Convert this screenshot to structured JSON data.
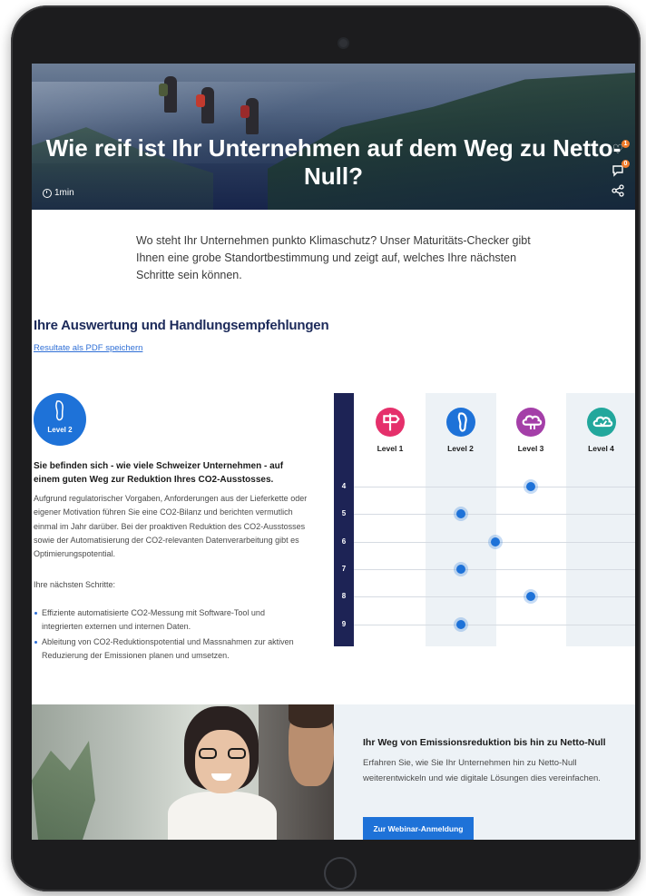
{
  "hero": {
    "title": "Wie reif ist Ihr Unternehmen auf dem Weg zu Netto-Null?",
    "duration": "1min",
    "like_count": "1",
    "comment_count": "0"
  },
  "intro": "Wo steht Ihr Unternehmen punkto Klimaschutz? Unser Maturitäts-Checker gibt Ihnen eine grobe Standortbestimmung und zeigt auf, welches Ihre nächsten Schritte sein können.",
  "evaluation": {
    "title": "Ihre Auswertung und Handlungsempfehlungen",
    "pdf_link": "Resultate als PDF speichern"
  },
  "result": {
    "level_label": "Level 2",
    "headline": "Sie befinden sich - wie viele Schweizer Unternehmen - auf einem guten Weg zur Reduktion Ihres CO2-Ausstosses.",
    "body": "Aufgrund regulatorischer Vorgaben, Anforderungen aus der Lieferkette oder eigener Motivation führen Sie eine CO2-Bilanz und berichten vermutlich einmal im Jahr darüber. Bei der proaktiven Reduktion des CO2-Ausstosses sowie der Automatisierung der CO2-relevanten Datenverarbeitung gibt es Optimierungspotential.",
    "next_steps_label": "Ihre nächsten Schritte:",
    "next_steps": [
      "Effiziente automatisierte CO2-Messung mit Software-Tool und integrierten externen und internen Daten.",
      "Ableitung von CO2-Reduktionspotential und Massnahmen zur aktiven Reduzierung der Emissionen planen und umsetzen."
    ]
  },
  "chart_data": {
    "type": "scatter",
    "categories": [
      "Level 1",
      "Level 2",
      "Level 3",
      "Level 4"
    ],
    "category_colors": [
      "#e5306b",
      "#1e72d8",
      "#a43fa8",
      "#22a79c"
    ],
    "icons": [
      "signpost-icon",
      "footprint-icon",
      "cloud-icon",
      "cloud-check-icon"
    ],
    "rows": [
      "4",
      "5",
      "6",
      "7",
      "8",
      "9"
    ],
    "points": [
      {
        "row": "4",
        "level": 3.0
      },
      {
        "row": "5",
        "level": 2.0
      },
      {
        "row": "6",
        "level": 2.5
      },
      {
        "row": "7",
        "level": 2.0
      },
      {
        "row": "8",
        "level": 3.0
      },
      {
        "row": "9",
        "level": 2.0
      }
    ],
    "grid": true
  },
  "webinar": {
    "title": "Ihr Weg von Emissionsreduktion bis hin zu Netto-Null",
    "body": "Erfahren Sie, wie Sie Ihr Unternehmen hin zu Netto-Null weiterentwickeln und wie digitale Lösungen dies vereinfachen.",
    "button": "Zur Webinar-Anmeldung"
  },
  "colors": {
    "accent_blue": "#1e72d8",
    "navy": "#1c2a5a",
    "badge_orange": "#f07b2a"
  }
}
